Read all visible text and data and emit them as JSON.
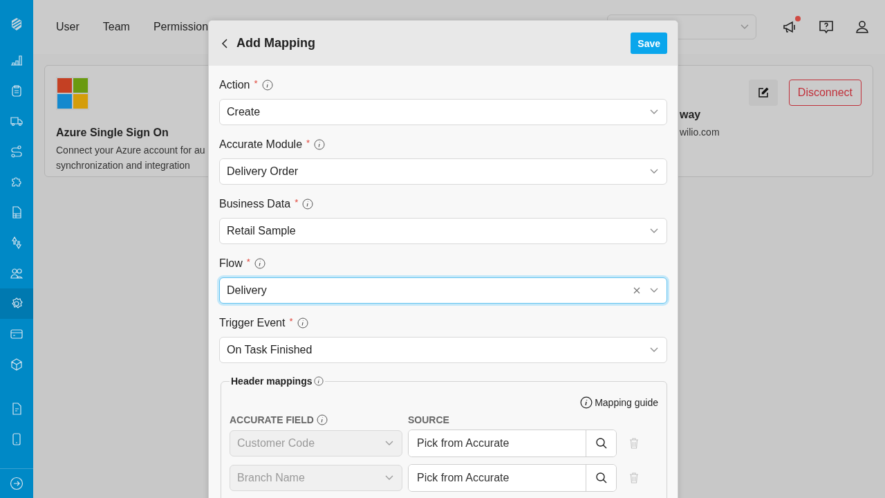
{
  "sidebar": {
    "items": [
      {
        "selected": false
      },
      {
        "selected": false
      },
      {
        "selected": false
      },
      {
        "selected": false
      },
      {
        "selected": false
      },
      {
        "selected": false
      },
      {
        "selected": false
      },
      {
        "selected": false
      },
      {
        "selected": true
      },
      {
        "selected": false
      },
      {
        "selected": false
      },
      {
        "selected": false
      },
      {
        "selected": false
      }
    ]
  },
  "top_nav": {
    "tabs": [
      {
        "label": "User"
      },
      {
        "label": "Team"
      },
      {
        "label": "Permission"
      }
    ],
    "notification": true
  },
  "cards": [
    {
      "title": "Azure Single Sign On",
      "description_lines": [
        "Connect your Azure account for au",
        "synchronization and integration"
      ]
    },
    {
      "title": "way",
      "description_lines": [
        "wilio.com"
      ],
      "action": "Disconnect"
    }
  ],
  "dialog": {
    "title": "Add Mapping",
    "save": "Save",
    "fields": [
      {
        "label": "Action",
        "required_mark": "*",
        "value": "Create",
        "focused": false
      },
      {
        "label": "Accurate Module",
        "required_mark": "*",
        "value": "Delivery Order",
        "focused": false
      },
      {
        "label": "Business Data",
        "required_mark": "*",
        "value": "Retail Sample",
        "focused": false
      },
      {
        "label": "Flow",
        "required_mark": "*",
        "value": "Delivery",
        "focused": true
      },
      {
        "label": "Trigger Event",
        "required_mark": "*",
        "value": "On Task Finished",
        "focused": false
      }
    ],
    "header_mappings": {
      "legend": "Header mappings",
      "guide": "Mapping guide",
      "columns": [
        "ACCURATE FIELD",
        "SOURCE"
      ],
      "rows": [
        {
          "field": "Customer Code",
          "disabled": true,
          "source_placeholder": "Pick from Accurate"
        },
        {
          "field": "Branch Name",
          "disabled": true,
          "source_placeholder": "Pick from Accurate"
        }
      ]
    }
  }
}
